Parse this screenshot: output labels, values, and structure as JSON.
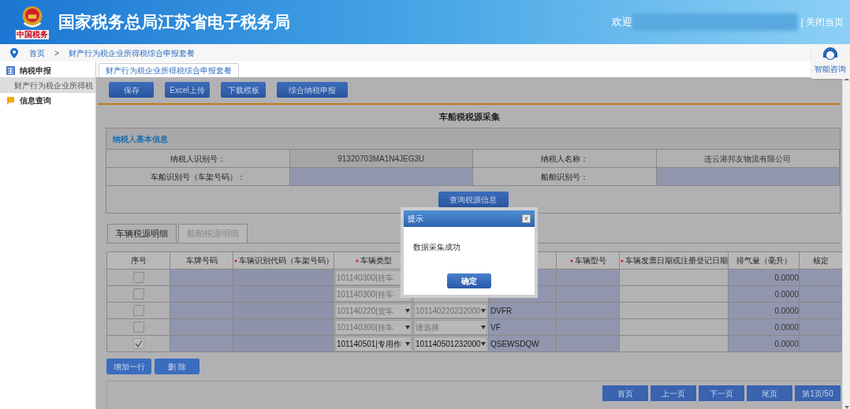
{
  "header": {
    "title": "国家税务总局江苏省电子税务局",
    "logo_caption": "中国税务",
    "welcome": "欢迎",
    "close_link": "| 关闭当页"
  },
  "breadcrumb": [
    "首页",
    ">",
    "财产行为税企业所得税综合申报套餐"
  ],
  "sidebar": {
    "items": [
      {
        "label": "纳税申报",
        "kind": "section",
        "children": [
          {
            "label": "财产行为税企业所得税",
            "selected": true
          }
        ]
      },
      {
        "label": "信息查询",
        "kind": "info"
      }
    ]
  },
  "help_widget": {
    "label": "智能咨询"
  },
  "page_tabs": [
    {
      "label": "财产行为税企业所得税综合申报套餐",
      "selected": true
    }
  ],
  "toolbar": [
    "保存",
    "Excel上传",
    "下载模板",
    "综合纳税申报"
  ],
  "form_title": "车船税税源采集",
  "basic_info": {
    "title": "纳税人基本信息",
    "fields": [
      {
        "label": "纳税人识别号：",
        "value": "91320703MA1N4JEG3U",
        "kind": "readonly"
      },
      {
        "label": "纳税人名称：",
        "value": "连云港邦友物流有限公司",
        "kind": "text"
      },
      {
        "label": "车船识别号（车架号码）：",
        "kind": "input"
      },
      {
        "label": "船舶识别号：",
        "kind": "input"
      }
    ],
    "query_button": "查询税源信息"
  },
  "detail_tabs": [
    {
      "label": "车辆税源明细",
      "selected": true
    },
    {
      "label": "船舶税源明细",
      "selected": false
    }
  ],
  "table": {
    "columns": [
      {
        "label": "序号",
        "required": false
      },
      {
        "label": "车牌号码",
        "required": false
      },
      {
        "label": "车辆识别代码（车架号码）",
        "required": true
      },
      {
        "label": "车辆类型",
        "required": true
      },
      null,
      null,
      {
        "label": "车辆型号",
        "required": true
      },
      {
        "label": "车辆发票日期或注册登记日期",
        "required": true
      },
      {
        "label": "排气量（毫升）",
        "required": false
      },
      {
        "label": "核定",
        "required": false
      }
    ],
    "rows": [
      {
        "checked": false,
        "disabled": true,
        "type": "101140300|挂车",
        "displacement": "0.0000"
      },
      {
        "checked": false,
        "disabled": true,
        "type": "101140300|挂车",
        "displacement": "0.0000"
      },
      {
        "checked": false,
        "disabled": true,
        "type": "101140220|货车",
        "code": "101140220232000",
        "model_code": "DVFR",
        "displacement": "0.0000"
      },
      {
        "checked": false,
        "disabled": true,
        "type": "101140300|挂车",
        "code": "请选择",
        "model_code": "VF",
        "displacement": "0.0000"
      },
      {
        "checked": true,
        "disabled": false,
        "type": "101140501|专用作",
        "code": "101140501232000",
        "model_code": "QSEWSDQW",
        "displacement": "0.0000"
      }
    ]
  },
  "row_buttons": [
    "增加一行",
    "删 除"
  ],
  "pager": [
    "首页",
    "上一页",
    "下一页",
    "尾页",
    "第1页/50"
  ],
  "dialog": {
    "title": "提示",
    "close": "×",
    "message": "数据采集成功",
    "ok": "确定"
  }
}
